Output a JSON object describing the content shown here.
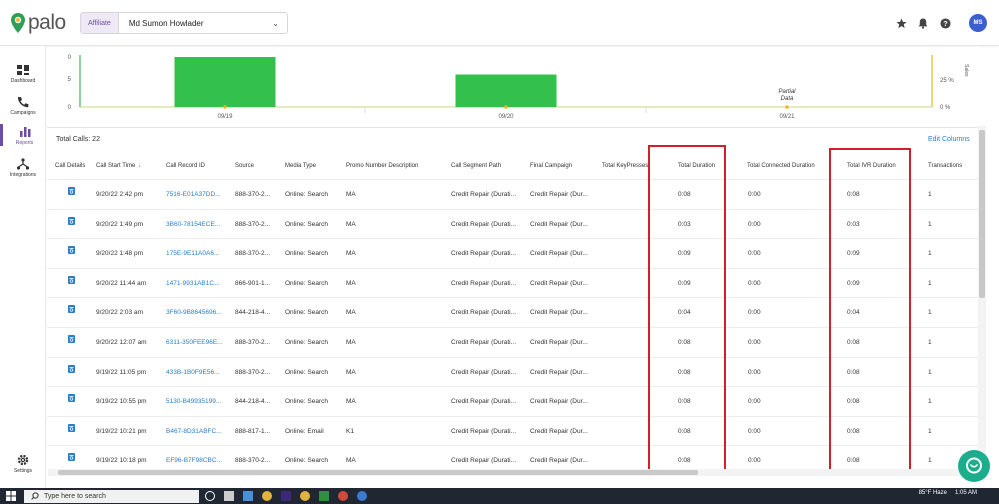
{
  "header": {
    "logo_text": "palo",
    "account_type": "Affiliate",
    "account_name": "Md Sumon Howlader",
    "avatar_initials": "MS"
  },
  "sidebar": {
    "items": [
      {
        "label": "Dashboard",
        "icon": "dashboard-icon"
      },
      {
        "label": "Campaigns",
        "icon": "phone-icon"
      },
      {
        "label": "Reports",
        "icon": "bar-chart-icon"
      },
      {
        "label": "Integrations",
        "icon": "integrations-icon"
      },
      {
        "label": "Settings",
        "icon": "gear-icon"
      }
    ]
  },
  "chart_data": {
    "type": "bar",
    "categories": [
      "09/19",
      "09/20",
      "09/21"
    ],
    "values": [
      10,
      6.5,
      0
    ],
    "left_axis_ticks": [
      "0",
      "5",
      "0"
    ],
    "right_axis_ticks": [
      "25 %",
      "0 %"
    ],
    "right_axis_label": "Sales",
    "annotation": "Partial Data",
    "bar_color": "#33c04d"
  },
  "summary": {
    "total_calls": "Total Calls: 22",
    "edit_columns": "Edit Columns"
  },
  "table": {
    "headers": [
      "Call Details",
      "Call Start Time",
      "Call Record ID",
      "Source",
      "Media Type",
      "Promo Number Description",
      "Call Segment Path",
      "Final Campaign",
      "Total KeyPresses",
      "Total Duration",
      "Total Connected Duration",
      "Total IVR Duration",
      "Transactions"
    ],
    "rows": [
      {
        "start": "9/20/22 2:42 pm",
        "record": "7516-E01A37DD...",
        "source": "888-370-2...",
        "media": "Online: Search",
        "promo": "MA",
        "segment": "Credit Repair (Durati...",
        "campaign": "Credit Repair (Dur...",
        "duration": "0:08",
        "connected": "0:00",
        "ivr": "0:08",
        "transactions": "1"
      },
      {
        "start": "9/20/22 1:49 pm",
        "record": "3B60-78154ECE...",
        "source": "888-370-2...",
        "media": "Online: Search",
        "promo": "MA",
        "segment": "Credit Repair (Durati...",
        "campaign": "Credit Repair (Dur...",
        "duration": "0:03",
        "connected": "0:00",
        "ivr": "0:03",
        "transactions": "1"
      },
      {
        "start": "9/20/22 1:48 pm",
        "record": "175E-9E11A0A6...",
        "source": "888-370-2...",
        "media": "Online: Search",
        "promo": "MA",
        "segment": "Credit Repair (Durati...",
        "campaign": "Credit Repair (Dur...",
        "duration": "0:09",
        "connected": "0:00",
        "ivr": "0:09",
        "transactions": "1"
      },
      {
        "start": "9/20/22 11:44 am",
        "record": "1471-9931AB1C...",
        "source": "866-901-1...",
        "media": "Online: Search",
        "promo": "MA",
        "segment": "Credit Repair (Durati...",
        "campaign": "Credit Repair (Dur...",
        "duration": "0:09",
        "connected": "0:00",
        "ivr": "0:09",
        "transactions": "1"
      },
      {
        "start": "9/20/22 2:03 am",
        "record": "3F60-9B8645696...",
        "source": "844-218-4...",
        "media": "Online: Search",
        "promo": "MA",
        "segment": "Credit Repair (Durati...",
        "campaign": "Credit Repair (Dur...",
        "duration": "0:04",
        "connected": "0:00",
        "ivr": "0:04",
        "transactions": "1"
      },
      {
        "start": "9/20/22 12:07 am",
        "record": "6311-350FEE96E...",
        "source": "888-370-2...",
        "media": "Online: Search",
        "promo": "MA",
        "segment": "Credit Repair (Durati...",
        "campaign": "Credit Repair (Dur...",
        "duration": "0:08",
        "connected": "0:00",
        "ivr": "0:08",
        "transactions": "1"
      },
      {
        "start": "9/19/22 11:05 pm",
        "record": "433B-1B0F9E56...",
        "source": "888-370-2...",
        "media": "Online: Search",
        "promo": "MA",
        "segment": "Credit Repair (Durati...",
        "campaign": "Credit Repair (Dur...",
        "duration": "0:08",
        "connected": "0:00",
        "ivr": "0:08",
        "transactions": "1"
      },
      {
        "start": "9/19/22 10:55 pm",
        "record": "5130-B49935199...",
        "source": "844-218-4...",
        "media": "Online: Search",
        "promo": "MA",
        "segment": "Credit Repair (Durati...",
        "campaign": "Credit Repair (Dur...",
        "duration": "0:08",
        "connected": "0:00",
        "ivr": "0:08",
        "transactions": "1"
      },
      {
        "start": "9/19/22 10:21 pm",
        "record": "B467-8D31ABFC...",
        "source": "888-817-1...",
        "media": "Online: Email",
        "promo": "K1",
        "segment": "Credit Repair (Durati...",
        "campaign": "Credit Repair (Dur...",
        "duration": "0:08",
        "connected": "0:00",
        "ivr": "0:08",
        "transactions": "1"
      },
      {
        "start": "9/19/22 10:18 pm",
        "record": "EF96-B7F98CBC...",
        "source": "888-370-2...",
        "media": "Online: Search",
        "promo": "MA",
        "segment": "Credit Repair (Durati...",
        "campaign": "Credit Repair (Dur...",
        "duration": "0:08",
        "connected": "0:00",
        "ivr": "0:08",
        "transactions": "1"
      }
    ]
  },
  "taskbar": {
    "search_placeholder": "Type here to search",
    "weather": "85°F  Haze",
    "time": "1:05 AM"
  },
  "colors": {
    "accent": "#6b4ea0",
    "link": "#2a7ec9",
    "highlight": "#d0212a",
    "bar": "#33c04d"
  }
}
